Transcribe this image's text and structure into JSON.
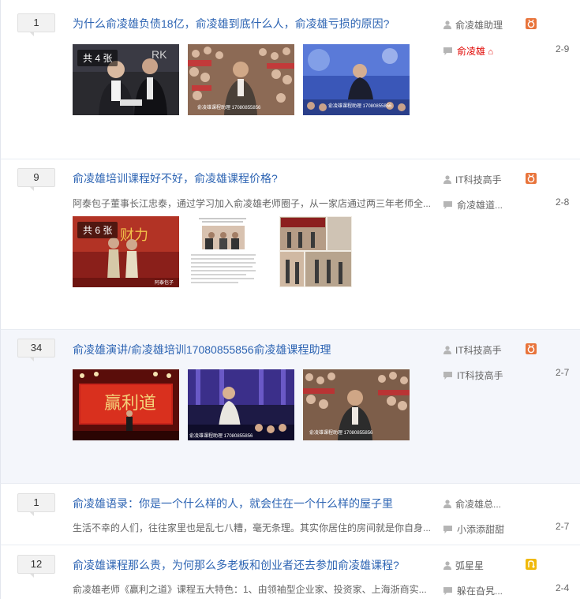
{
  "colors": {
    "link": "#2d64b3",
    "red": "#e10602",
    "level_orange": "#e8743b",
    "level_yellow": "#f0b90b"
  },
  "threads": [
    {
      "reply_count": "1",
      "title": "为什么俞凌雄负债18亿，俞凌雄到底什么人，俞凌雄亏损的原因?",
      "badge": "共 4 张",
      "author": "俞凌雄助理",
      "last_replier": "俞凌雄",
      "last_replier_mark": "⌂",
      "date": "2-9"
    },
    {
      "reply_count": "9",
      "title": "俞凌雄培训课程好不好，俞凌雄课程价格?",
      "abstract": "阿泰包子董事长江忠泰，通过学习加入俞凌雄老师圈子，从一家店通过两三年老师全...",
      "badge": "共 6 张",
      "author": "IT科技高手",
      "last_replier": "俞凌雄道...",
      "date": "2-8"
    },
    {
      "reply_count": "34",
      "title": "俞凌雄演讲/俞凌雄培训17080855856俞凌雄课程助理",
      "author": "IT科技高手",
      "last_replier": "IT科技高手",
      "date": "2-7"
    },
    {
      "reply_count": "1",
      "title": "俞凌雄语录：你是一个什么样的人，就会住在一个什么样的屋子里",
      "abstract": "生活不幸的人们，往往家里也是乱七八糟，毫无条理。其实你居住的房间就是你自身...",
      "author": "俞凌雄总...",
      "last_replier": "小添添甜甜",
      "date": "2-7"
    },
    {
      "reply_count": "12",
      "title": "俞凌雄课程那么贵，为何那么多老板和创业者还去参加俞凌雄课程?",
      "abstract": "俞凌雄老师《赢利之道》课程五大特色：1、由领袖型企业家、投资家、上海浙商实...",
      "author": "弧星星",
      "last_replier": "躲在旮旯...",
      "date": "2-4"
    }
  ]
}
